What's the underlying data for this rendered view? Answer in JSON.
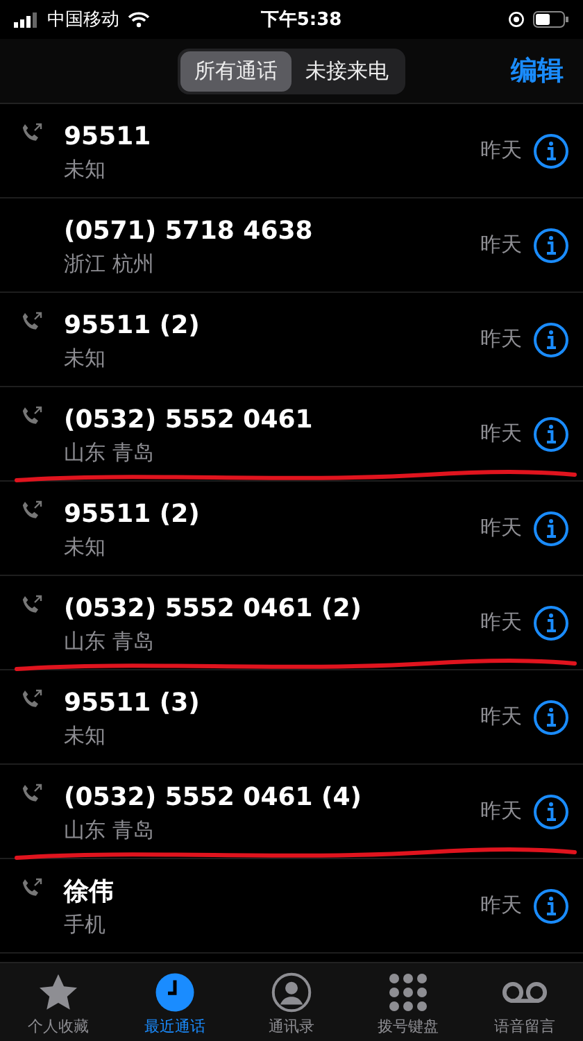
{
  "status_bar": {
    "carrier": "中国移动",
    "time": "下午5:38"
  },
  "segments": [
    {
      "label": "所有通话",
      "selected": true
    },
    {
      "label": "未接来电",
      "selected": false
    }
  ],
  "edit_button": "编辑",
  "calls": [
    {
      "name": "95511",
      "detail": "未知",
      "date": "昨天",
      "outgoing": true,
      "marked": false
    },
    {
      "name": "(0571) 5718 4638",
      "detail": "浙江 杭州",
      "date": "昨天",
      "outgoing": false,
      "marked": false
    },
    {
      "name": "95511 (2)",
      "detail": "未知",
      "date": "昨天",
      "outgoing": true,
      "marked": false
    },
    {
      "name": "(0532) 5552 0461",
      "detail": "山东 青岛",
      "date": "昨天",
      "outgoing": true,
      "marked": true
    },
    {
      "name": "95511 (2)",
      "detail": "未知",
      "date": "昨天",
      "outgoing": true,
      "marked": false
    },
    {
      "name": "(0532) 5552 0461 (2)",
      "detail": "山东 青岛",
      "date": "昨天",
      "outgoing": true,
      "marked": true
    },
    {
      "name": "95511 (3)",
      "detail": "未知",
      "date": "昨天",
      "outgoing": true,
      "marked": false
    },
    {
      "name": "(0532) 5552 0461 (4)",
      "detail": "山东 青岛",
      "date": "昨天",
      "outgoing": true,
      "marked": true
    },
    {
      "name": "徐伟",
      "detail": "手机",
      "date": "昨天",
      "outgoing": true,
      "marked": false
    }
  ],
  "tab_bar": [
    {
      "kind": "favorites",
      "label": "个人收藏",
      "selected": false
    },
    {
      "kind": "recents",
      "label": "最近通话",
      "selected": true
    },
    {
      "kind": "contacts",
      "label": "通讯录",
      "selected": false
    },
    {
      "kind": "keypad",
      "label": "拨号键盘",
      "selected": false
    },
    {
      "kind": "voicemail",
      "label": "语音留言",
      "selected": false
    }
  ]
}
